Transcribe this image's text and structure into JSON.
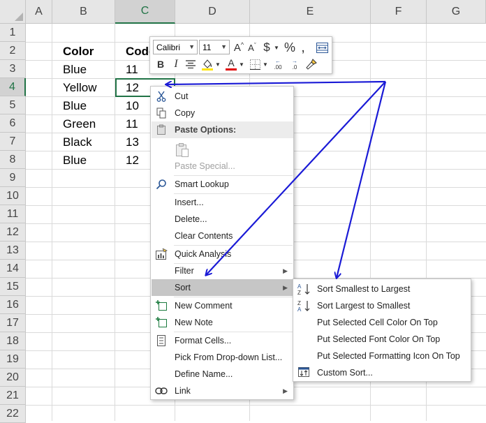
{
  "columns": [
    "A",
    "B",
    "C",
    "D",
    "E",
    "F",
    "G"
  ],
  "rows": [
    "1",
    "2",
    "3",
    "4",
    "5",
    "6",
    "7",
    "8",
    "9",
    "10",
    "11",
    "12",
    "13",
    "14",
    "15",
    "16",
    "17",
    "18",
    "19",
    "20",
    "21",
    "22"
  ],
  "table": {
    "header": {
      "color": "Color",
      "code": "Code"
    },
    "data": [
      {
        "color": "Blue",
        "code": "11"
      },
      {
        "color": "Yellow",
        "code": "12"
      },
      {
        "color": "Blue",
        "code": "10"
      },
      {
        "color": "Green",
        "code": "11"
      },
      {
        "color": "Black",
        "code": "13"
      },
      {
        "color": "Blue",
        "code": "12"
      }
    ]
  },
  "mini_toolbar": {
    "font_name": "Calibri",
    "font_size": "11",
    "grow_font": "A",
    "shrink_font": "A",
    "currency": "$",
    "percent": "%",
    "comma": ",",
    "bold": "B",
    "italic": "I",
    "font_color": "A",
    "inc_decimal": ".00",
    "dec_decimal": ".0"
  },
  "context_menu": {
    "cut": "Cut",
    "copy": "Copy",
    "paste_options": "Paste Options:",
    "paste_special": "Paste Special...",
    "smart_lookup": "Smart Lookup",
    "insert": "Insert...",
    "delete": "Delete...",
    "clear_contents": "Clear Contents",
    "quick_analysis": "Quick Analysis",
    "filter": "Filter",
    "sort": "Sort",
    "new_comment": "New Comment",
    "new_note": "New Note",
    "format_cells": "Format Cells...",
    "pick_list": "Pick From Drop-down List...",
    "define_name": "Define Name...",
    "link": "Link"
  },
  "sort_submenu": {
    "smallest_largest": "Sort Smallest to Largest",
    "largest_smallest": "Sort Largest to Smallest",
    "cell_color": "Put Selected Cell Color On Top",
    "font_color": "Put Selected Font Color On Top",
    "formatting_icon": "Put Selected Formatting Icon On Top",
    "custom_sort": "Custom Sort..."
  },
  "colors": {
    "excel_green": "#217346",
    "annotation_arrow": "#1a1ad6",
    "font_color_bar": "#e00000",
    "highlight_bar": "#ffe500"
  }
}
